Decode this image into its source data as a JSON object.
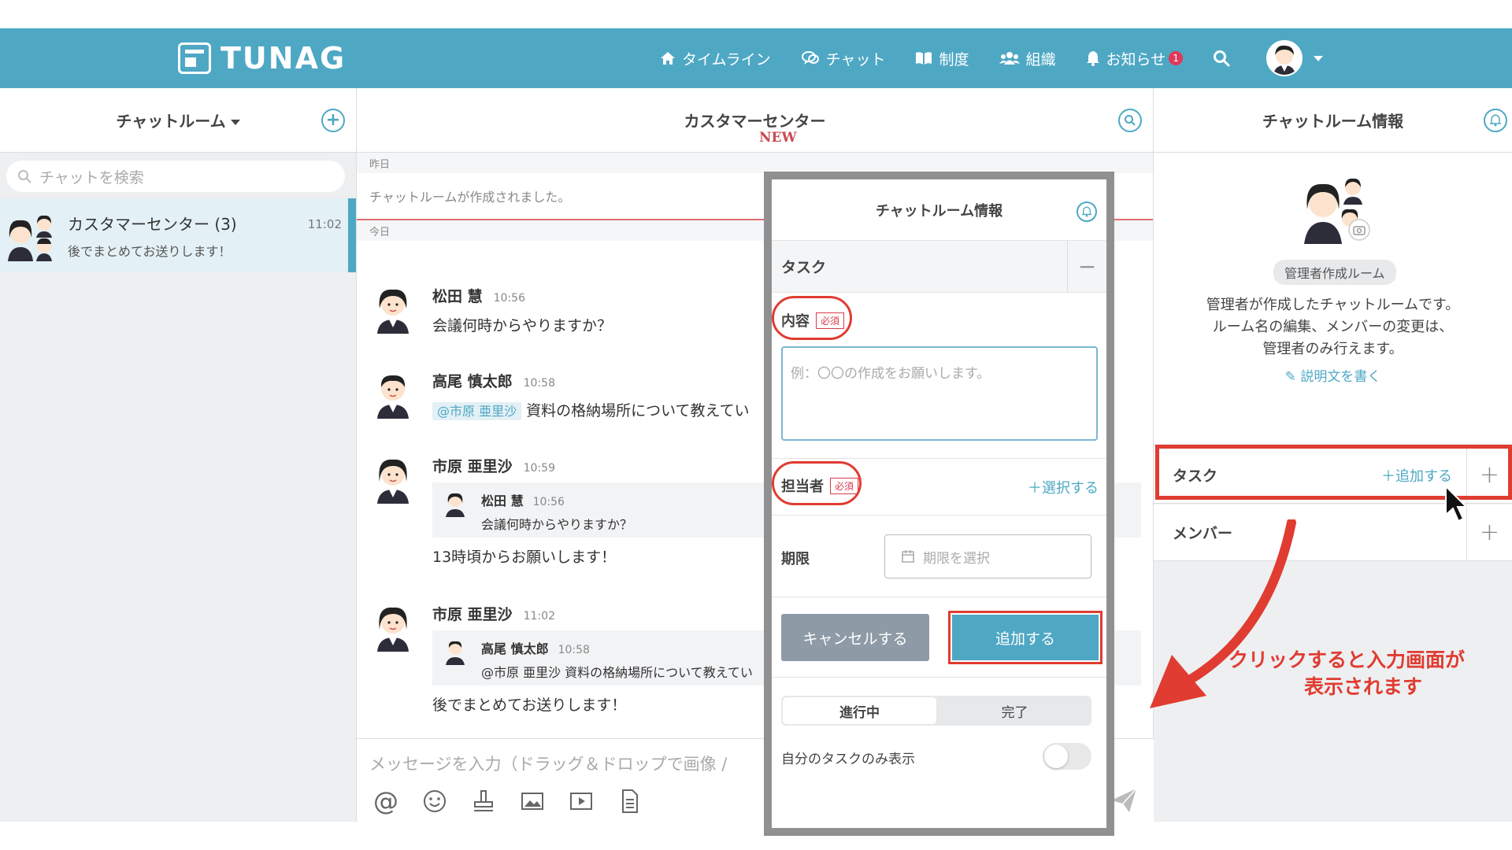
{
  "header": {
    "logo": "TUNAG",
    "nav": [
      {
        "label": "タイムライン",
        "icon": "home-icon"
      },
      {
        "label": "チャット",
        "icon": "chat-icon"
      },
      {
        "label": "制度",
        "icon": "book-icon"
      },
      {
        "label": "組織",
        "icon": "group-icon"
      },
      {
        "label": "お知らせ",
        "icon": "bell-icon",
        "badge": "1"
      }
    ]
  },
  "left": {
    "title": "チャットルーム",
    "search_placeholder": "チャットを検索",
    "room": {
      "name": "カスタマーセンター (3)",
      "last": "後でまとめてお送りします！",
      "time": "11:02"
    }
  },
  "middle": {
    "title": "カスタマーセンター",
    "yesterday": "昨日",
    "system": "チャットルームが作成されました。",
    "new": "NEW",
    "today": "今日",
    "messages": [
      {
        "name": "松田 慧",
        "time": "10:56",
        "text": "会議何時からやりますか？"
      },
      {
        "name": "高尾 慎太郎",
        "time": "10:58",
        "mention": "@市原 亜里沙",
        "text": "資料の格納場所について教えてい"
      },
      {
        "name": "市原 亜里沙",
        "time": "10:59",
        "quote_name": "松田 慧",
        "quote_time": "10:56",
        "quote_text": "会議何時からやりますか？",
        "text": "13時頃からお願いします！"
      },
      {
        "name": "市原 亜里沙",
        "time": "11:02",
        "quote_name": "高尾 慎太郎",
        "quote_time": "10:58",
        "quote_text": "@市原 亜里沙 資料の格納場所について教えてい",
        "text": "後でまとめてお送りします！"
      }
    ],
    "input_placeholder": "メッセージを入力（ドラッグ＆ドロップで画像 /"
  },
  "right": {
    "title": "チャットルーム情報",
    "admin_tag": "管理者作成ルーム",
    "desc": [
      "管理者が作成したチャットルームです。",
      "ルーム名の編集、メンバーの変更は、",
      "管理者のみ行えます。"
    ],
    "write_link": "説明文を書く",
    "task": "タスク",
    "task_add": "＋追加する",
    "member": "メンバー"
  },
  "popup": {
    "title": "チャットルーム情報",
    "task": "タスク",
    "content_label": "内容",
    "required": "必須",
    "content_placeholder": "例：〇〇の作成をお願いします。",
    "assignee_label": "担当者",
    "select_link": "＋選択する",
    "due_label": "期限",
    "due_placeholder": "期限を選択",
    "cancel": "キャンセルする",
    "add": "追加する",
    "seg_active": "進行中",
    "seg_done": "完了",
    "own_only": "自分のタスクのみ表示"
  },
  "annotation": [
    "クリックすると入力画面が",
    "表示されます"
  ],
  "colors": {
    "brand": "#4ea8c4",
    "highlight": "#e03c31"
  }
}
